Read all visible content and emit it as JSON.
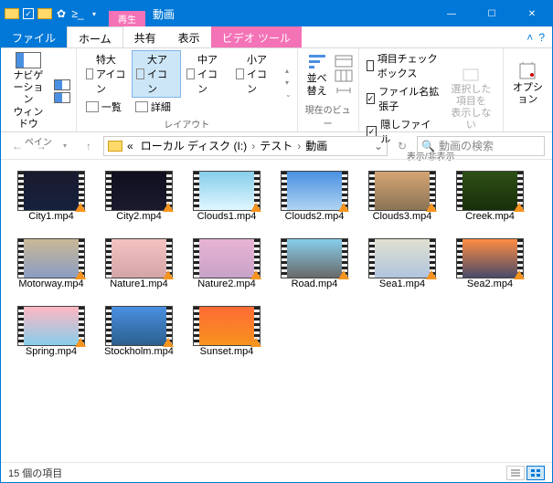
{
  "titlebar": {
    "context_header": "再生",
    "context_tab": "ビデオ ツール",
    "title": "動画",
    "min": "—",
    "max": "☐",
    "close": "✕"
  },
  "ribbon_tabs": {
    "file": "ファイル",
    "home": "ホーム",
    "share": "共有",
    "view": "表示",
    "video": "ビデオ ツール"
  },
  "ribbon": {
    "pane": {
      "nav": "ナビゲーション\nウィンドウ",
      "group": "ペイン"
    },
    "layout": {
      "xl": "特大アイコン",
      "lg": "大アイコン",
      "md": "中アイコン",
      "sm": "小アイコン",
      "list": "一覧",
      "detail": "詳細",
      "group": "レイアウト"
    },
    "curview": {
      "sort": "並べ替え",
      "group": "現在のビュー"
    },
    "show": {
      "chk": "項目チェック ボックス",
      "ext": "ファイル名拡張子",
      "hidden": "隠しファイル",
      "hide_btn": "選択した項目を\n表示しない",
      "group": "表示/非表示"
    },
    "options": "オプション"
  },
  "addr": {
    "crumbs": [
      "ローカル ディスク (I:)",
      "テスト",
      "動画"
    ],
    "prefix": "«",
    "search_ph": "動画の検索"
  },
  "files": [
    {
      "name": "City1.mp4",
      "bg": "linear-gradient(#1a1a2e,#16213e)"
    },
    {
      "name": "City2.mp4",
      "bg": "linear-gradient(#0f0f1e,#1a1a2e)"
    },
    {
      "name": "Clouds1.mp4",
      "bg": "linear-gradient(#87ceeb,#e0f6ff)"
    },
    {
      "name": "Clouds2.mp4",
      "bg": "linear-gradient(#4a90e2,#b0d4f1)"
    },
    {
      "name": "Clouds3.mp4",
      "bg": "linear-gradient(#d4a574,#8b7355)"
    },
    {
      "name": "Creek.mp4",
      "bg": "linear-gradient(#2d5016,#1a2f0a)"
    },
    {
      "name": "Motorway.mp4",
      "bg": "linear-gradient(#c9b896,#8b9dc3)"
    },
    {
      "name": "Nature1.mp4",
      "bg": "linear-gradient(#f4c2c2,#d4a5a5)"
    },
    {
      "name": "Nature2.mp4",
      "bg": "linear-gradient(#e8b4d4,#c8a2c8)"
    },
    {
      "name": "Road.mp4",
      "bg": "linear-gradient(#87ceeb,#696969)"
    },
    {
      "name": "Sea1.mp4",
      "bg": "linear-gradient(#e0e0d0,#b0c4de)"
    },
    {
      "name": "Sea2.mp4",
      "bg": "linear-gradient(#ff8c42,#4a4a6a)"
    },
    {
      "name": "Spring.mp4",
      "bg": "linear-gradient(#ffb6c1,#87ceeb)"
    },
    {
      "name": "Stockholm.mp4",
      "bg": "linear-gradient(#4a90e2,#2c5f8d)"
    },
    {
      "name": "Sunset.mp4",
      "bg": "linear-gradient(#ff6b35,#f7931e)"
    }
  ],
  "status": {
    "count": "15 個の項目"
  }
}
